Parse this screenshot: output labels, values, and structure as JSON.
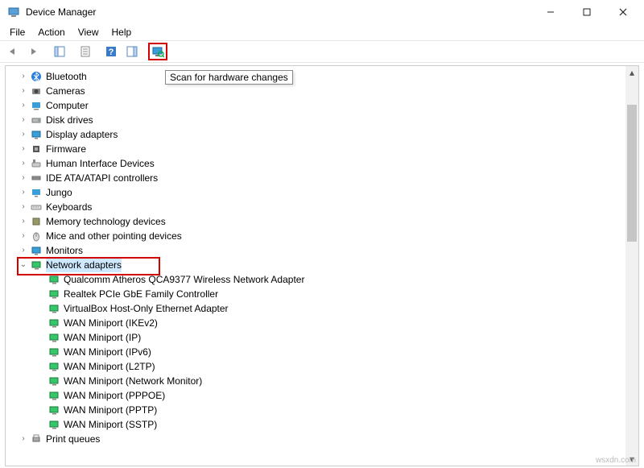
{
  "window": {
    "title": "Device Manager"
  },
  "menu": {
    "file": "File",
    "action": "Action",
    "view": "View",
    "help": "Help"
  },
  "tooltip": "Scan for hardware changes",
  "tree": {
    "bluetooth": "Bluetooth",
    "cameras": "Cameras",
    "computer": "Computer",
    "diskdrives": "Disk drives",
    "display": "Display adapters",
    "firmware": "Firmware",
    "hid": "Human Interface Devices",
    "ide": "IDE ATA/ATAPI controllers",
    "jungo": "Jungo",
    "keyboards": "Keyboards",
    "memtech": "Memory technology devices",
    "mice": "Mice and other pointing devices",
    "monitors": "Monitors",
    "netadapters": "Network adapters",
    "qualcomm": "Qualcomm Atheros QCA9377 Wireless Network Adapter",
    "realtek": "Realtek PCIe GbE Family Controller",
    "virtualbox": "VirtualBox Host-Only Ethernet Adapter",
    "wan_ikev2": "WAN Miniport (IKEv2)",
    "wan_ip": "WAN Miniport (IP)",
    "wan_ipv6": "WAN Miniport (IPv6)",
    "wan_l2tp": "WAN Miniport (L2TP)",
    "wan_netmon": "WAN Miniport (Network Monitor)",
    "wan_pppoe": "WAN Miniport (PPPOE)",
    "wan_pptp": "WAN Miniport (PPTP)",
    "wan_sstp": "WAN Miniport (SSTP)",
    "printqueues": "Print queues"
  },
  "watermark": "wsxdn.com"
}
